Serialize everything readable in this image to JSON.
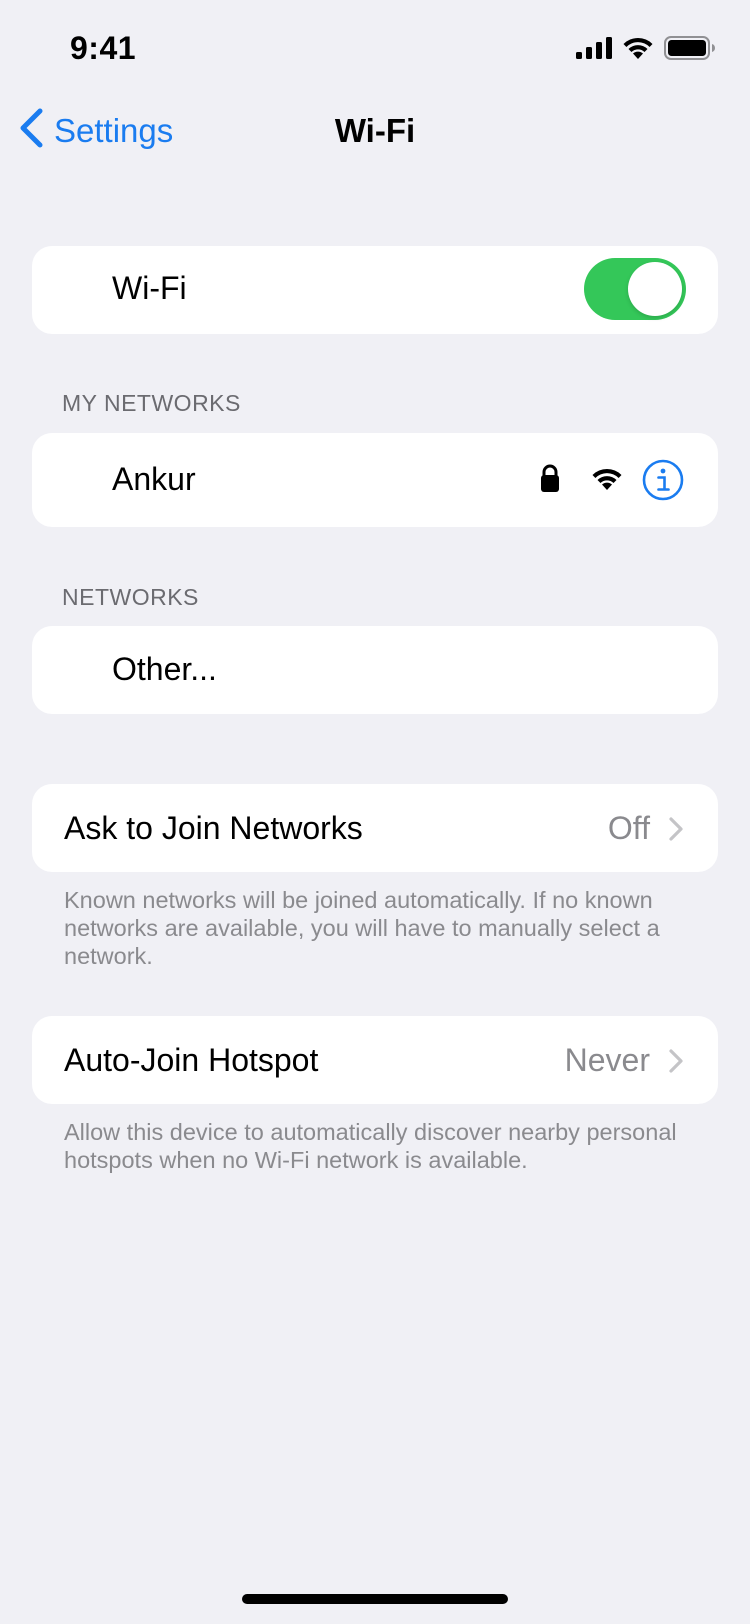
{
  "status_bar": {
    "time": "9:41"
  },
  "nav": {
    "back_label": "Settings",
    "title": "Wi-Fi"
  },
  "wifi_toggle": {
    "label": "Wi-Fi",
    "enabled": true
  },
  "my_networks": {
    "header": "MY NETWORKS",
    "items": [
      {
        "name": "Ankur",
        "secured": true
      }
    ]
  },
  "networks": {
    "header": "NETWORKS",
    "other_label": "Other..."
  },
  "ask_to_join": {
    "label": "Ask to Join Networks",
    "value": "Off",
    "footnote": "Known networks will be joined automatically. If no known networks are available, you will have to manually select a network."
  },
  "auto_join_hotspot": {
    "label": "Auto-Join Hotspot",
    "value": "Never",
    "footnote": "Allow this device to automatically discover nearby personal hotspots when no Wi-Fi network is available."
  },
  "colors": {
    "background": "#f0f0f5",
    "accent": "#1a7cf0",
    "toggle_on": "#34c759",
    "secondary_text": "#8a8a8e"
  },
  "icons": [
    "cellular-signal-icon",
    "wifi-icon",
    "battery-icon",
    "chevron-left-icon",
    "lock-icon",
    "wifi-signal-icon",
    "info-icon",
    "chevron-right-icon"
  ]
}
